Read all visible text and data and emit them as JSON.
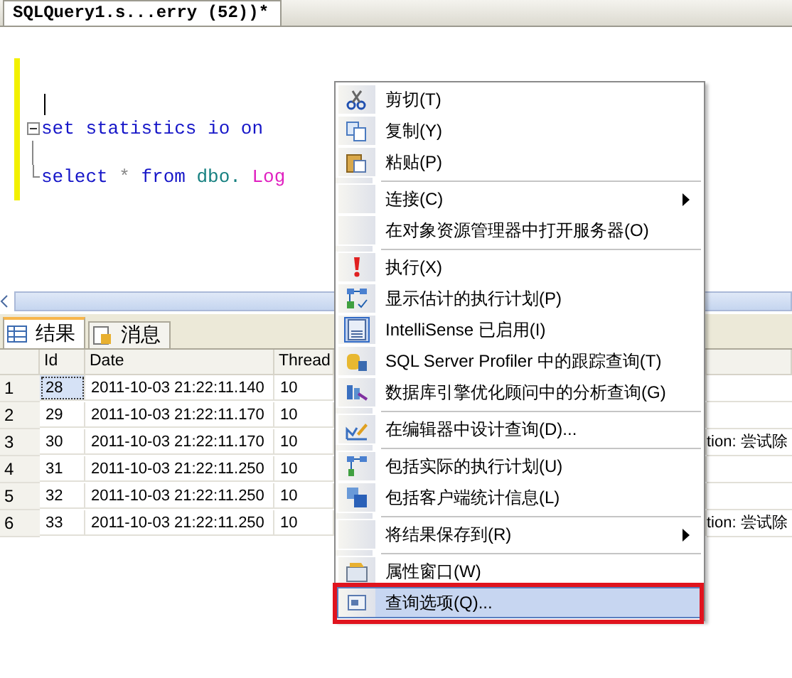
{
  "editor_tab": {
    "title": "SQLQuery1.s...erry (52))*",
    "selected": true
  },
  "editor": {
    "lines": [
      {
        "caret": true,
        "kind": "blank"
      },
      {
        "caret": false,
        "kind": "fold_start",
        "tokens": [
          {
            "kind": "keyword",
            "text": "set"
          },
          {
            "kind": "keyword",
            "text": "statistics"
          },
          {
            "kind": "keyword",
            "text": "io"
          },
          {
            "kind": "keyword",
            "text": "on"
          }
        ]
      },
      {
        "caret": false,
        "kind": "fold_line"
      },
      {
        "caret": false,
        "kind": "fold_end",
        "tokens": [
          {
            "kind": "keyword",
            "text": "select"
          },
          {
            "kind": "operator",
            "text": "*"
          },
          {
            "kind": "keyword",
            "text": "from"
          },
          {
            "kind": "schema",
            "text": "dbo."
          },
          {
            "kind": "object",
            "text": "Log"
          }
        ]
      }
    ]
  },
  "result_tabs": [
    {
      "label": "结果",
      "selected": true
    },
    {
      "label": "消息",
      "selected": false
    }
  ],
  "table": {
    "columns": [
      "Id",
      "Date",
      "Thread"
    ],
    "rows": [
      {
        "number": "1",
        "cells": [
          "28",
          "2011-10-03 21:22:11.140",
          "10"
        ],
        "selected": true
      },
      {
        "number": "2",
        "cells": [
          "29",
          "2011-10-03 21:22:11.170",
          "10"
        ],
        "selected": false
      },
      {
        "number": "3",
        "cells": [
          "30",
          "2011-10-03 21:22:11.170",
          "10"
        ],
        "selected": false,
        "column_5": "tion: 尝试除"
      },
      {
        "number": "4",
        "cells": [
          "31",
          "2011-10-03 21:22:11.250",
          "10"
        ],
        "selected": false
      },
      {
        "number": "5",
        "cells": [
          "32",
          "2011-10-03 21:22:11.250",
          "10"
        ],
        "selected": false
      },
      {
        "number": "6",
        "cells": [
          "33",
          "2011-10-03 21:22:11.250",
          "10"
        ],
        "selected": false,
        "column_5": "tion: 尝试除"
      }
    ]
  },
  "context_menu": {
    "items": [
      {
        "kind": "item",
        "label": "剪切(T)",
        "checked": false,
        "submenu": false,
        "selected": false
      },
      {
        "kind": "item",
        "label": "复制(Y)",
        "checked": false,
        "submenu": false,
        "selected": false
      },
      {
        "kind": "item",
        "label": "粘贴(P)",
        "checked": false,
        "submenu": false,
        "selected": false
      },
      {
        "kind": "separator"
      },
      {
        "kind": "item",
        "label": "连接(C)",
        "checked": false,
        "submenu": true,
        "selected": false
      },
      {
        "kind": "item",
        "label": "在对象资源管理器中打开服务器(O)",
        "checked": false,
        "submenu": false,
        "selected": false
      },
      {
        "kind": "separator"
      },
      {
        "kind": "item",
        "label": "执行(X)",
        "checked": false,
        "submenu": false,
        "selected": false
      },
      {
        "kind": "item",
        "label": "显示估计的执行计划(P)",
        "checked": false,
        "submenu": false,
        "selected": false
      },
      {
        "kind": "item",
        "label": "IntelliSense 已启用(I)",
        "checked": true,
        "submenu": false,
        "selected": false
      },
      {
        "kind": "item",
        "label": "SQL Server Profiler 中的跟踪查询(T)",
        "checked": false,
        "submenu": false,
        "selected": false
      },
      {
        "kind": "item",
        "label": "数据库引擎优化顾问中的分析查询(G)",
        "checked": false,
        "submenu": false,
        "selected": false
      },
      {
        "kind": "separator"
      },
      {
        "kind": "item",
        "label": "在编辑器中设计查询(D)...",
        "checked": false,
        "submenu": false,
        "selected": false
      },
      {
        "kind": "separator"
      },
      {
        "kind": "item",
        "label": "包括实际的执行计划(U)",
        "checked": false,
        "submenu": false,
        "selected": false
      },
      {
        "kind": "item",
        "label": "包括客户端统计信息(L)",
        "checked": false,
        "submenu": false,
        "selected": false
      },
      {
        "kind": "separator"
      },
      {
        "kind": "item",
        "label": "将结果保存到(R)",
        "checked": false,
        "submenu": true,
        "selected": false
      },
      {
        "kind": "separator"
      },
      {
        "kind": "item",
        "label": "属性窗口(W)",
        "checked": false,
        "submenu": false,
        "selected": false
      },
      {
        "kind": "item",
        "label": "查询选项(Q)...",
        "checked": false,
        "submenu": false,
        "selected": true
      }
    ]
  }
}
